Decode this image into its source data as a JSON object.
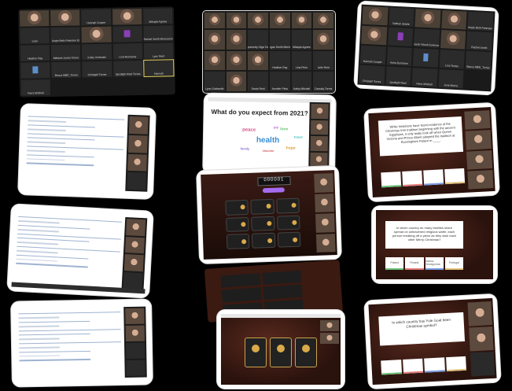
{
  "gallery1": {
    "tiles": [
      "",
      "",
      "Hannah Cooper",
      "",
      "Mikayla Agnew",
      "Liam",
      "Angie Beth Petersen Et",
      "",
      "M",
      "Rachel Smith Monument",
      "Heather Ray",
      "Melanie Jones Torres",
      "Kristy Uchimaki",
      "Lina Munsamy",
      "Lynn Reid",
      "X",
      "Becca MBD_Torres",
      "Christgirl Torres",
      "Spotlight Reel Torres",
      "Hannah",
      "Kiera Mitchell"
    ]
  },
  "gallery2": {
    "tiles": [
      "",
      "",
      "",
      "",
      "",
      "",
      "",
      "",
      "Opportunity Olga Torres",
      "Megan Smith Mitchell",
      "Mikayla Agnew",
      "",
      "",
      "",
      "",
      "Heather Ray",
      "Lina Pinto",
      "Julie Reid",
      "Lynn Goldsmith",
      "",
      "Sarah Reid",
      "Jennifer Pinto",
      "Kathy Mitchell",
      "Cassidy Torres"
    ]
  },
  "gallery3": {
    "tiles": [
      "",
      "Nathan Steele",
      "",
      "",
      "Angie Beth Petersen",
      "",
      "M",
      "Sarah Wood-Dunmore",
      "",
      "Rachel Smith",
      "Hannah Cooper",
      "Anita Dunmore",
      "X",
      "Lina Torres",
      "Becca MBD_Torres",
      "Christgirl Torres",
      "Spotlight Reel",
      "Kiera Mitchell",
      "Jane Morris"
    ]
  },
  "wordcloud": {
    "title": "What do you expect from 2021?",
    "words": [
      {
        "t": "health",
        "c": "#3b8fd6",
        "s": 10
      },
      {
        "t": "peace",
        "c": "#d65a8a",
        "s": 6
      },
      {
        "t": "love",
        "c": "#6bbf7a",
        "s": 5
      },
      {
        "t": "hope",
        "c": "#e0a03b",
        "s": 5
      },
      {
        "t": "family",
        "c": "#8a6bd6",
        "s": 4
      },
      {
        "t": "vaccine",
        "c": "#d65a5a",
        "s": 4
      },
      {
        "t": "travel",
        "c": "#3bbfbf",
        "s": 4
      },
      {
        "t": "joy",
        "c": "#b85ad6",
        "s": 4
      }
    ]
  },
  "quiz1": {
    "question": "While historians have found evidence of the Christmas tree tradition beginning with the ancient Egyptians, it only really took off when Queen Victoria and Prince Albert adopted the tradition at Buckingham Palace in ____."
  },
  "quiz2": {
    "question": "In which country do many families share spread on unleavened religious wafer, each person breaking off a piece as they wish each other Merry Christmas?",
    "answers": [
      "Poland",
      "Finland",
      "Bosnia-Herzegovina",
      "Portugal"
    ]
  },
  "quiz3": {
    "question": "In which country has Yule Goat been Christmas symbol?",
    "answers": [
      "",
      "",
      "",
      ""
    ]
  },
  "feud": {
    "score": "000001",
    "start": "START"
  }
}
